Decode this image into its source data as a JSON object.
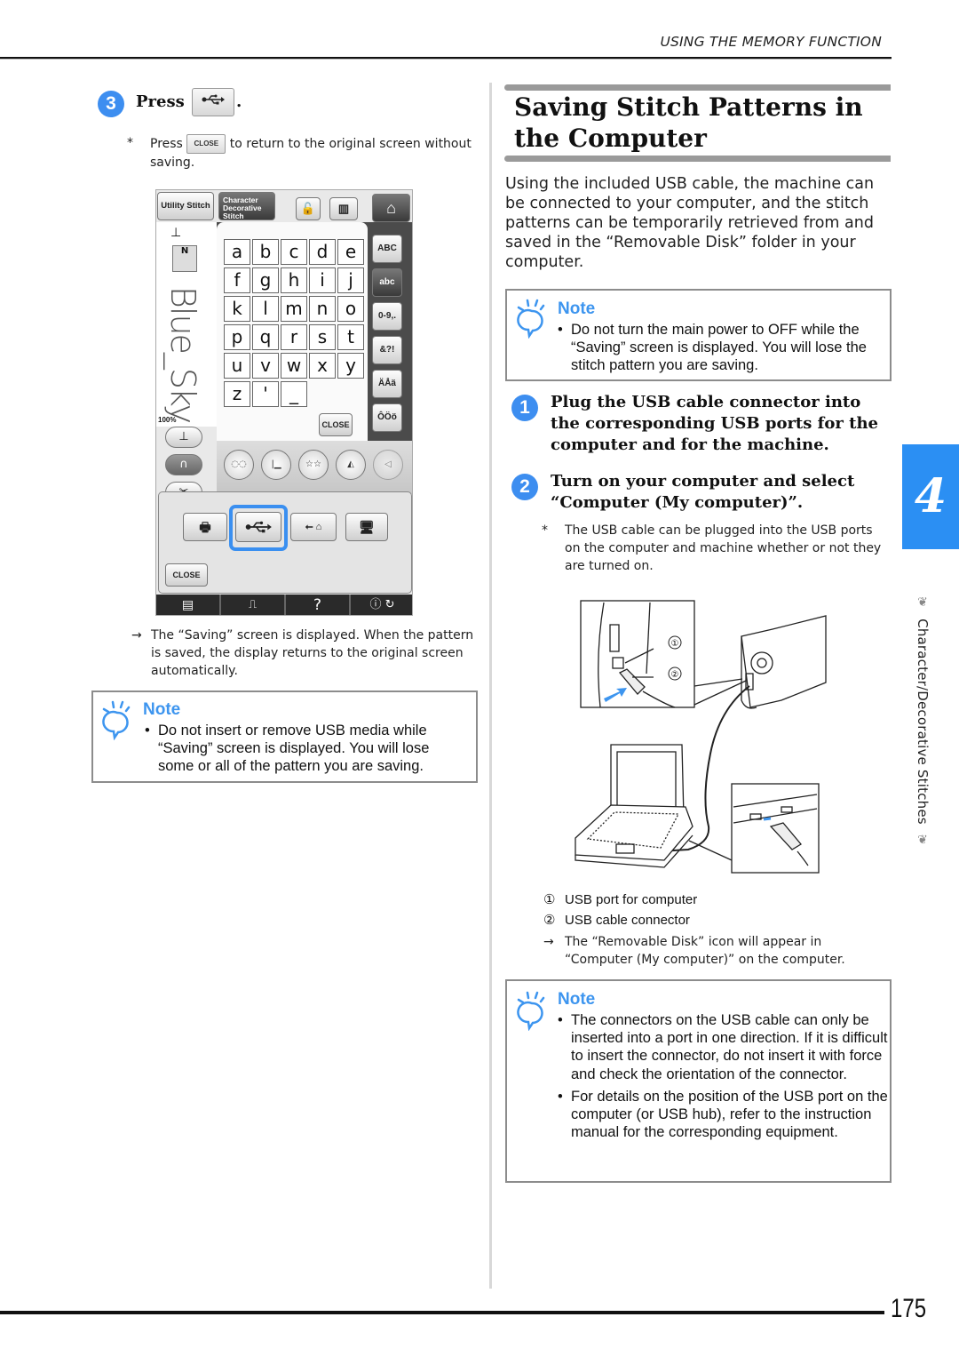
{
  "header": {
    "running_head": "USING THE MEMORY FUNCTION"
  },
  "left_column": {
    "step3": {
      "number": "3",
      "label": "Press",
      "button_icon": "usb-icon",
      "suffix": "."
    },
    "step3_tip": {
      "mark": "*",
      "pre": "Press",
      "close_button_label": "CLOSE",
      "post": "to return to the original screen without saving."
    },
    "machine_screen": {
      "tabs": [
        "Utility Stitch",
        "Character Decorative Stitch"
      ],
      "top_icons": [
        "lock-icon",
        "book-icon",
        "home-icon"
      ],
      "keys": [
        "a",
        "b",
        "c",
        "d",
        "e",
        "f",
        "g",
        "h",
        "i",
        "j",
        "k",
        "l",
        "m",
        "n",
        "o",
        "p",
        "q",
        "r",
        "s",
        "t",
        "u",
        "v",
        "w",
        "x",
        "y",
        "z",
        "'",
        "_"
      ],
      "category_buttons": [
        "ABC",
        "abc",
        "0-9,.",
        "&?!",
        "ÄÅä",
        "ÔÖö"
      ],
      "selected_category": "abc",
      "preview_text": "Blue_Sky",
      "zoom_label": "100%",
      "close_label": "CLOSE",
      "popup_close_label": "CLOSE",
      "save_destinations": [
        "machine-memory-icon",
        "usb-icon",
        "usb-mouse-icon",
        "computer-usb-icon"
      ],
      "selected_destination": "usb-icon",
      "bottom_bar": [
        "page-icon",
        "machine-icon",
        "?",
        "settings-icon"
      ]
    },
    "result": {
      "mark": "→",
      "text": "The “Saving” screen is displayed. When the pattern is saved, the display returns to the original screen automatically."
    },
    "note": {
      "title": "Note",
      "items": [
        "Do not insert or remove USB media while “Saving” screen is displayed. You will lose some or all of the pattern you are saving."
      ]
    }
  },
  "right_column": {
    "section_title": "Saving Stitch Patterns in the Computer",
    "intro": "Using the included USB cable, the machine can be connected to your computer, and the stitch patterns can be temporarily retrieved from and saved in the “Removable Disk” folder in your computer.",
    "note1": {
      "title": "Note",
      "items": [
        "Do not turn the main power to OFF while the “Saving” screen is displayed. You will lose the stitch pattern you are saving."
      ]
    },
    "step1": {
      "number": "1",
      "text": "Plug the USB cable connector into the corresponding USB ports for the computer and for the machine."
    },
    "step2": {
      "number": "2",
      "text": "Turn on your computer and select “Computer (My computer)”."
    },
    "step2_tip": {
      "mark": "*",
      "text": "The USB cable can be plugged into the USB ports on the computer and machine whether or not they are turned on."
    },
    "illustration": {
      "callouts": [
        "①",
        "②"
      ]
    },
    "legend": [
      {
        "mark": "①",
        "text": "USB port for computer"
      },
      {
        "mark": "②",
        "text": "USB cable connector"
      }
    ],
    "result": {
      "mark": "→",
      "text": "The “Removable Disk” icon will appear in “Computer (My computer)” on the computer."
    },
    "note2": {
      "title": "Note",
      "items": [
        "The connectors on the USB cable can only be inserted into a port in one direction. If it is difficult to insert the connector, do not insert it with force and check the orientation of the connector.",
        "For details on the position of the USB port on the computer (or USB hub), refer to the instruction manual for the corresponding equipment."
      ]
    }
  },
  "side_tab": {
    "chapter": "4",
    "label": "Character/Decorative Stitches"
  },
  "footer": {
    "page_number": "175"
  },
  "colors": {
    "accent_blue": "#3d8ef0",
    "tab_blue": "#2b8ff3",
    "note_title": "#3d95ef"
  }
}
